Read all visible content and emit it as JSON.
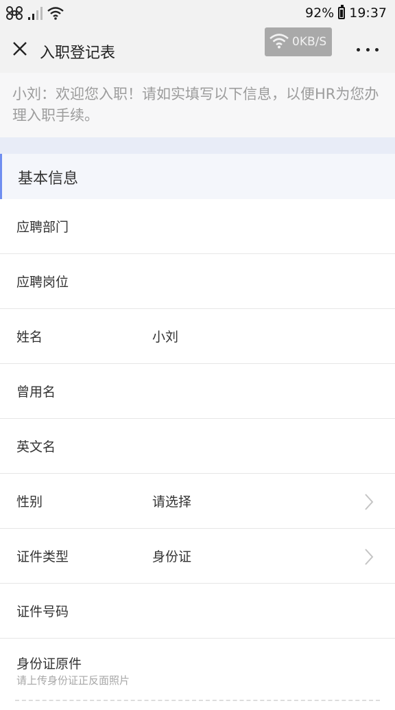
{
  "status_bar": {
    "carrier_icon": "china-unicom-icon",
    "signal_icon": "signal-bars-icon",
    "wifi_icon": "wifi-icon",
    "battery_percent": "92%",
    "battery_level": 0.92,
    "time": "19:37"
  },
  "nav": {
    "close_icon": "close-icon",
    "title": "入职登记表",
    "network_speed": "0KB/S",
    "more_icon": "more-icon"
  },
  "welcome_text": "小刘：欢迎您入职！请如实填写以下信息，以便HR为您办理入职手续。",
  "section": {
    "title": "基本信息",
    "accent": "#6f8ef0"
  },
  "fields": [
    {
      "label": "应聘部门",
      "value": ""
    },
    {
      "label": "应聘岗位",
      "value": ""
    },
    {
      "label": "姓名",
      "value": "小刘"
    },
    {
      "label": "曾用名",
      "value": ""
    },
    {
      "label": "英文名",
      "value": ""
    },
    {
      "label": "性别",
      "value": "请选择",
      "chevron": true
    },
    {
      "label": "证件类型",
      "value": "身份证",
      "chevron": true
    },
    {
      "label": "证件号码",
      "value": ""
    },
    {
      "label": "身份证原件",
      "hint": "请上传身份证正反面照片"
    }
  ]
}
